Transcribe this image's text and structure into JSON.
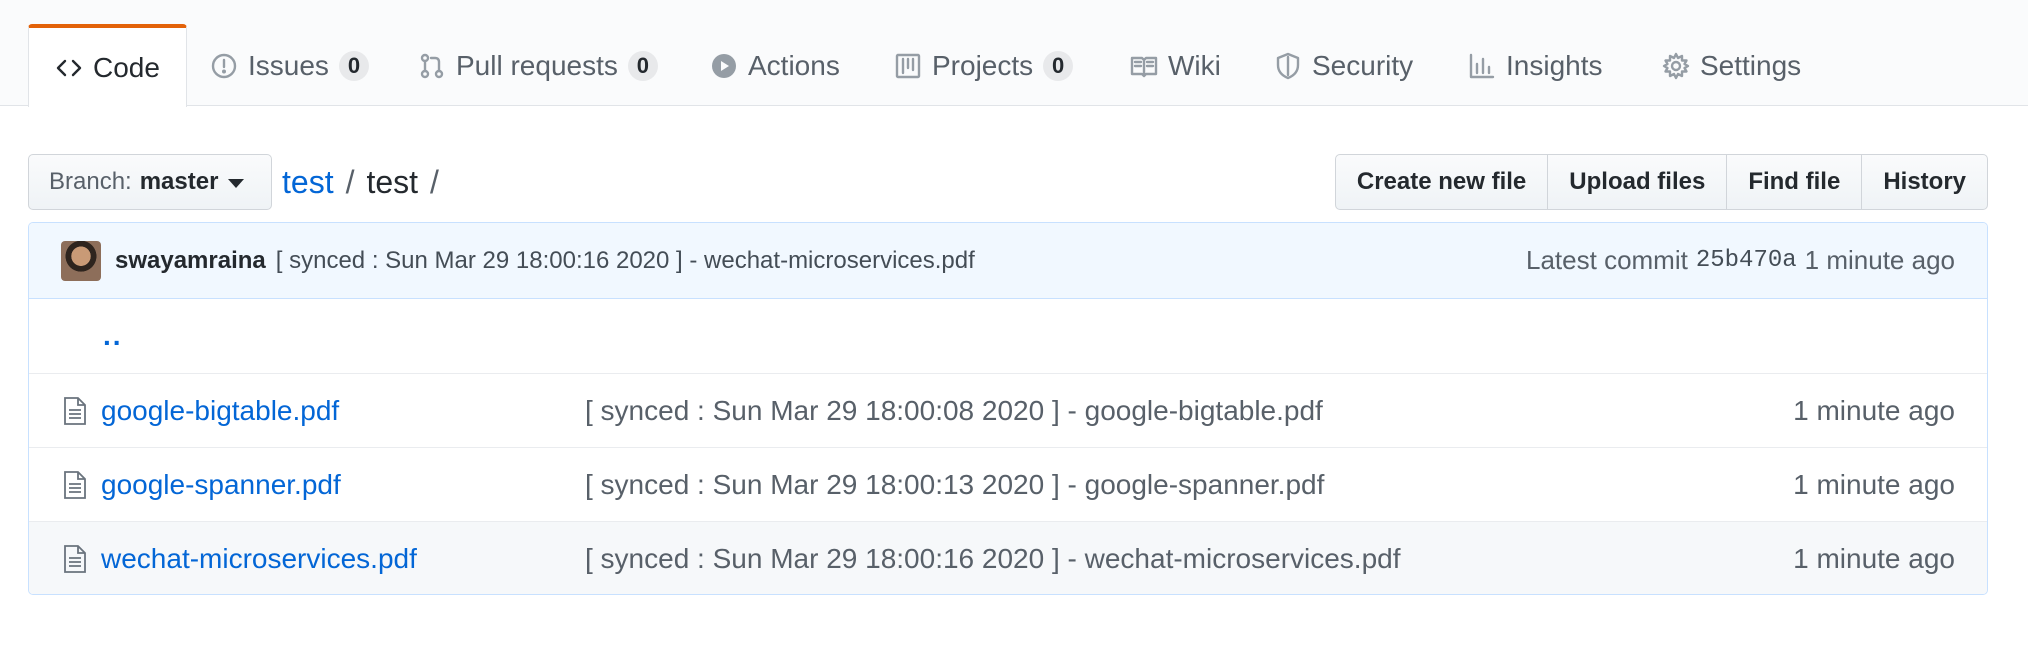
{
  "tabs": [
    {
      "label": "Code",
      "icon": "code-icon",
      "selected": true
    },
    {
      "label": "Issues",
      "icon": "issue-icon",
      "count": "0"
    },
    {
      "label": "Pull requests",
      "icon": "pull-request-icon",
      "count": "0"
    },
    {
      "label": "Actions",
      "icon": "play-icon"
    },
    {
      "label": "Projects",
      "icon": "project-icon",
      "count": "0"
    },
    {
      "label": "Wiki",
      "icon": "book-icon"
    },
    {
      "label": "Security",
      "icon": "shield-icon"
    },
    {
      "label": "Insights",
      "icon": "graph-icon"
    },
    {
      "label": "Settings",
      "icon": "gear-icon"
    }
  ],
  "branch": {
    "prefix": "Branch:",
    "name": "master"
  },
  "breadcrumb": {
    "repo": "test",
    "sep1": "/",
    "folder": "test",
    "sep2": "/"
  },
  "actions": {
    "create": "Create new file",
    "upload": "Upload files",
    "find": "Find file",
    "history": "History"
  },
  "commit": {
    "author": "swayamraina",
    "message": "[ synced : Sun Mar 29 18:00:16 2020 ] - wechat-microservices.pdf",
    "latest_label": "Latest commit",
    "sha": "25b470a",
    "age": "1 minute ago"
  },
  "parent_link": "..",
  "files": [
    {
      "name": "google-bigtable.pdf",
      "message": "[ synced : Sun Mar 29 18:00:08 2020 ] - google-bigtable.pdf",
      "age": "1 minute ago"
    },
    {
      "name": "google-spanner.pdf",
      "message": "[ synced : Sun Mar 29 18:00:13 2020 ] - google-spanner.pdf",
      "age": "1 minute ago"
    },
    {
      "name": "wechat-microservices.pdf",
      "message": "[ synced : Sun Mar 29 18:00:16 2020 ] - wechat-microservices.pdf",
      "age": "1 minute ago"
    }
  ],
  "colors": {
    "accent": "#e36209",
    "link": "#0366d6",
    "commit_bg": "#f1f8ff"
  }
}
